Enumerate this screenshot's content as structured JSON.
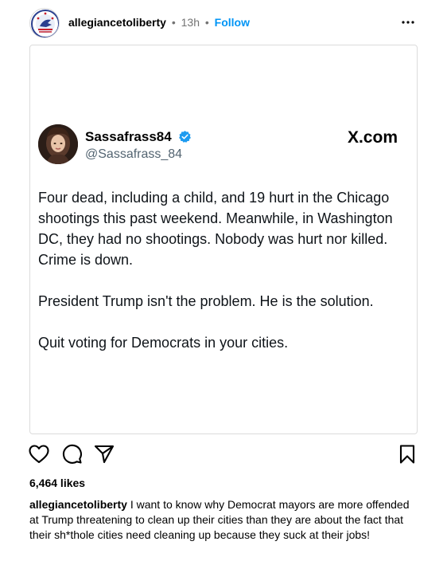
{
  "header": {
    "username": "allegiancetoliberty",
    "separator": "•",
    "time": "13h",
    "follow_label": "Follow"
  },
  "tweet": {
    "name": "Sassafrass84",
    "handle": "@Sassafrass_84",
    "source": "X.com",
    "paragraphs": [
      "Four dead, including a child, and 19 hurt in the Chicago shootings this past weekend. Meanwhile, in Washington DC, they had no shootings. Nobody was hurt nor killed. Crime is down.",
      "President Trump isn't the problem. He is the solution.",
      "Quit voting for Democrats in your cities."
    ]
  },
  "engagement": {
    "likes": "6,464 likes"
  },
  "caption": {
    "username": "allegiancetoliberty",
    "text": "I want to know why Democrat mayors are more offended at Trump threatening to clean up their cities than they are about the fact that their sh*thole cities need cleaning up because they suck at their jobs!"
  },
  "icons": {
    "more": "more-options-icon",
    "like": "heart-icon",
    "comment": "comment-icon",
    "share": "share-icon",
    "save": "bookmark-icon",
    "verified": "verified-badge-icon"
  },
  "colors": {
    "link": "#0095f6",
    "muted": "#737373",
    "verified": "#1d9bf0",
    "border": "#dbdbdb"
  }
}
